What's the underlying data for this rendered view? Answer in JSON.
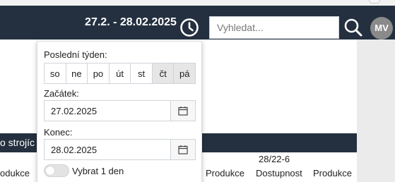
{
  "header": {
    "date_range": "27.2. - 28.02.2025",
    "search_placeholder": "Vyhledat...",
    "avatar_initials": "MV",
    "clock_icon": "clock-icon",
    "search_icon": "search-icon"
  },
  "section": {
    "title": "o strojíc"
  },
  "columns": {
    "col1": "odukce",
    "col2": "Produkce",
    "col3_line1": "28/22-6",
    "col3_line2": "Dostupnost",
    "col4": "Produkce"
  },
  "picker": {
    "last_week_label": "Poslední týden:",
    "days": [
      {
        "label": "so",
        "selected": false
      },
      {
        "label": "ne",
        "selected": false
      },
      {
        "label": "po",
        "selected": false
      },
      {
        "label": "út",
        "selected": false
      },
      {
        "label": "st",
        "selected": false
      },
      {
        "label": "čt",
        "selected": true
      },
      {
        "label": "pá",
        "selected": true
      }
    ],
    "start_label": "Začátek:",
    "start_value": "27.02.2025",
    "end_label": "Konec:",
    "end_value": "28.02.2025",
    "single_day_label": "Vybrat 1 den",
    "single_day_enabled": false,
    "calendar_icon": "calendar-icon"
  },
  "colors": {
    "header_bg": "#24303f",
    "selected_day_bg": "#e6e6e6",
    "avatar_bg": "#8a8a8a"
  }
}
